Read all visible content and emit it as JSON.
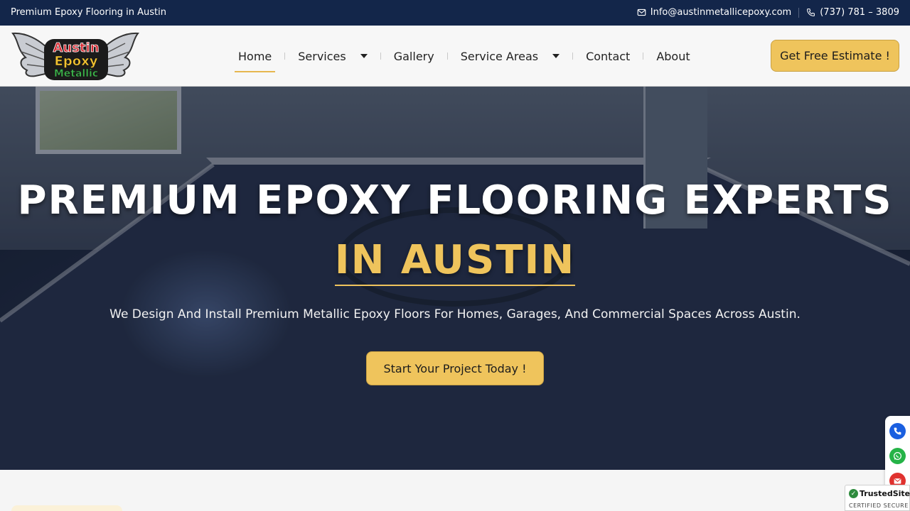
{
  "topbar": {
    "tagline": "Premium Epoxy Flooring in Austin",
    "email": "Info@austinmetallicepoxy.com",
    "phone": "(737) 781 – 3809"
  },
  "logo": {
    "line1": "Austin",
    "line2": "Epoxy",
    "line3": "Metallic"
  },
  "nav": {
    "items": [
      {
        "label": "Home",
        "active": true,
        "dropdown": false
      },
      {
        "label": "Services",
        "active": false,
        "dropdown": true
      },
      {
        "label": "Gallery",
        "active": false,
        "dropdown": false
      },
      {
        "label": "Service Areas",
        "active": false,
        "dropdown": true
      },
      {
        "label": "Contact",
        "active": false,
        "dropdown": false
      },
      {
        "label": "About",
        "active": false,
        "dropdown": false
      }
    ],
    "cta": "Get Free Estimate !"
  },
  "hero": {
    "title": "PREMIUM EPOXY FLOORING EXPERTS",
    "subtitle": "IN AUSTIN",
    "lead": "We Design And Install Premium Metallic Epoxy Floors For Homes, Garages, And Commercial Spaces Across Austin.",
    "cta": "Start Your Project Today !"
  },
  "floating": {
    "icons": [
      "phone-icon",
      "whatsapp-icon",
      "email-icon"
    ],
    "colors": {
      "phone": "#1a5fe0",
      "whatsapp": "#25b347",
      "email": "#e0322f"
    }
  },
  "trusted": {
    "title": "TrustedSite",
    "subtitle": "CERTIFIED SECURE"
  },
  "colors": {
    "topbar": "#13264a",
    "accent": "#efc45c"
  }
}
